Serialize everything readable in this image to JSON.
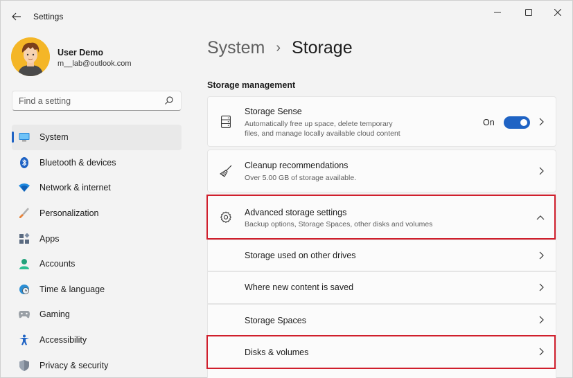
{
  "window": {
    "title": "Settings"
  },
  "user": {
    "name": "User Demo",
    "email": "m__lab@outlook.com"
  },
  "search": {
    "placeholder": "Find a setting"
  },
  "sidebar": {
    "items": [
      {
        "label": "System",
        "icon": "monitor-icon",
        "active": true
      },
      {
        "label": "Bluetooth & devices",
        "icon": "bluetooth-icon"
      },
      {
        "label": "Network & internet",
        "icon": "wifi-icon"
      },
      {
        "label": "Personalization",
        "icon": "brush-icon"
      },
      {
        "label": "Apps",
        "icon": "apps-icon"
      },
      {
        "label": "Accounts",
        "icon": "person-icon"
      },
      {
        "label": "Time & language",
        "icon": "globe-clock-icon"
      },
      {
        "label": "Gaming",
        "icon": "gamepad-icon"
      },
      {
        "label": "Accessibility",
        "icon": "accessibility-icon"
      },
      {
        "label": "Privacy & security",
        "icon": "shield-icon"
      }
    ]
  },
  "breadcrumb": {
    "parent": "System",
    "separator": "›",
    "current": "Storage"
  },
  "storage_management": {
    "heading": "Storage management",
    "storage_sense": {
      "title": "Storage Sense",
      "description_line1": "Automatically free up space, delete temporary",
      "description_line2": "files, and manage locally available cloud content",
      "toggle_state": "On",
      "toggle_on": true
    },
    "cleanup": {
      "title": "Cleanup recommendations",
      "description": "Over 5.00 GB of storage available."
    },
    "advanced": {
      "title": "Advanced storage settings",
      "description": "Backup options, Storage Spaces, other disks and volumes",
      "expanded": true,
      "sub_items": [
        "Storage used on other drives",
        "Where new content is saved",
        "Storage Spaces",
        "Disks & volumes"
      ]
    }
  },
  "colors": {
    "accent": "#1f63c4",
    "highlight": "#d01f2c"
  }
}
